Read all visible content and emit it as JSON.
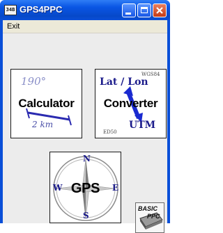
{
  "window": {
    "title": "GPS4PPC",
    "app_icon_text": "34B",
    "accent_color": "#0a4fd8"
  },
  "menu": {
    "exit_label": "Exit"
  },
  "tiles": {
    "calculator": {
      "label": "Calculator",
      "angle_text": "190°",
      "distance_text": "2 km"
    },
    "converter": {
      "label": "Converter",
      "latlon_text": "Lat / Lon",
      "utm_text": "UTM",
      "wgs_text": "WGS84",
      "ed_text": "ED50"
    },
    "gps": {
      "label": "GPS",
      "compass_n": "N",
      "compass_s": "S",
      "compass_e": "E",
      "compass_w": "W"
    },
    "basic": {
      "text_top": "BASIC",
      "text_bottom": "PPC"
    }
  }
}
